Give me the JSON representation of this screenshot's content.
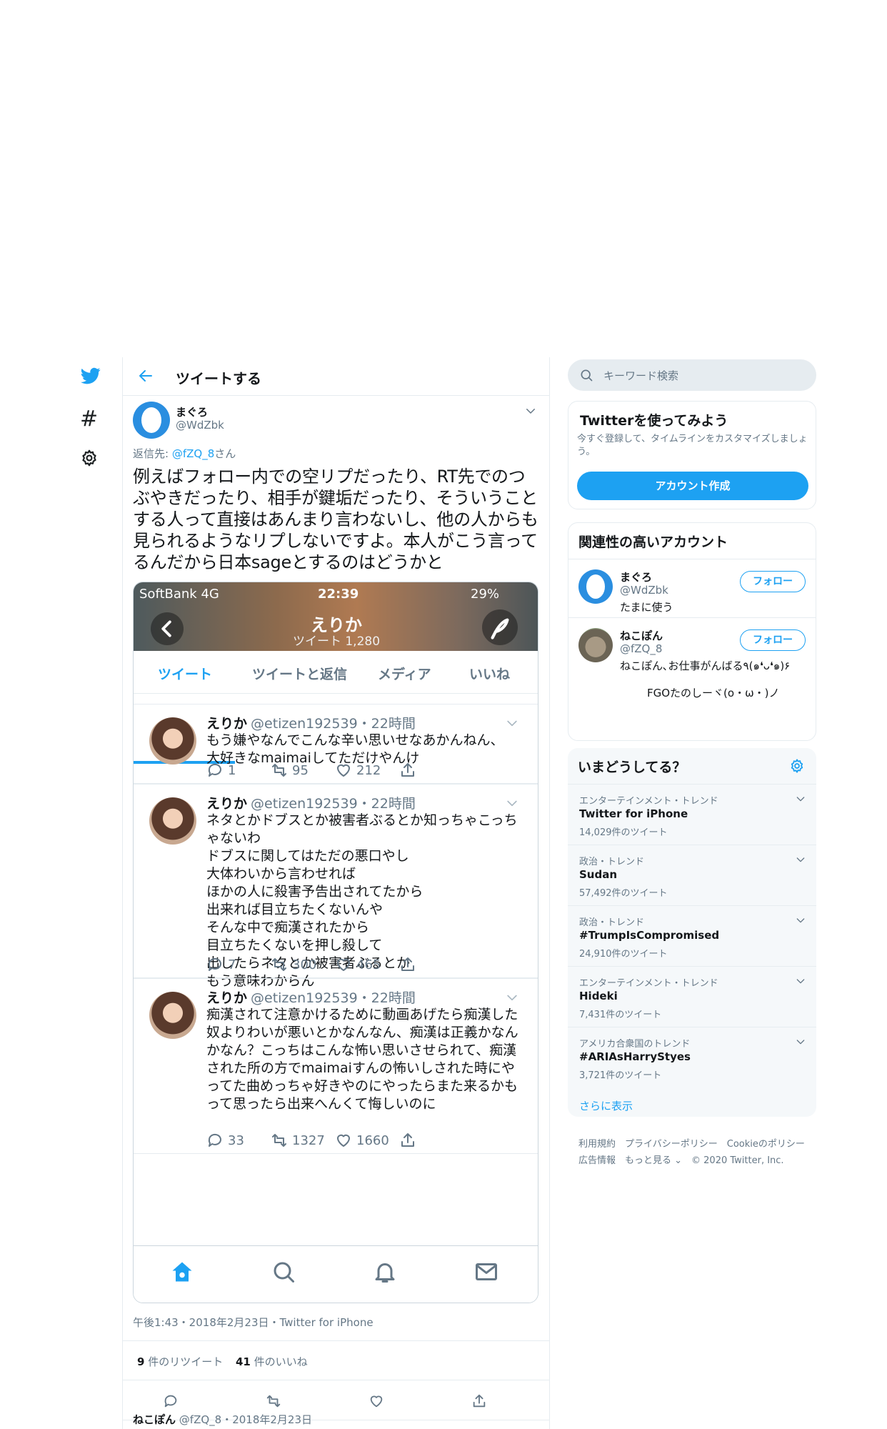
{
  "nav": {
    "bird_icon": "twitter-bird-icon",
    "hash_icon": "hashtag-icon",
    "hash_glyph": "#",
    "gear_icon": "gear-icon"
  },
  "header": {
    "title": "ツイートする"
  },
  "tweet": {
    "name": "まぐろ",
    "handle": "@WdZbk",
    "reply_prefix": "返信先: ",
    "reply_handle": "@fZQ_8",
    "reply_suffix": "さん",
    "text": "例えばフォロー内での空リプだったり、RT先でのつぶやきだったり、相手が鍵垢だったり、そういうことする人って直接はあんまり言わないし、他の人からも見られるようなリプしないですよ。本人がこう言ってるんだから日本sageとするのはどうかと",
    "meta": "午後1:43・2018年2月23日・Twitter for iPhone",
    "retweets_count": "9",
    "retweets_label": "件のリツイート",
    "likes_count": "41",
    "likes_label": "件のいいね"
  },
  "screenshot": {
    "carrier": "SoftBank  4G",
    "time": "22:39",
    "battery": "29%",
    "profile_name": "えりか",
    "profile_sub": "ツイート 1,280",
    "tabs": [
      "ツイート",
      "ツイートと返信",
      "メディア",
      "いいね"
    ],
    "cards": [
      {
        "name": "えりか",
        "handle": "@etizen192539・22時間",
        "body": "もう嫌やなんでこんな辛い思いせなあかんねん、\n大好きなmaimaiしてただけやんけ",
        "reply": "1",
        "rt": "95",
        "like": "212"
      },
      {
        "name": "えりか",
        "handle": "@etizen192539・22時間",
        "body": "ネタとかドブスとか被害者ぶるとか知っちゃこっちゃないわ\nドブスに関してはただの悪口やし\n大体わいから言わせれば\nほかの人に殺害予告出されてたから\n出来れば目立ちたくないんや\nそんな中で痴漢されたから\n目立ちたくないを押し殺して\n出したらネタとか被害者ぶるとか\nもう意味わからん",
        "reply": "7",
        "rt": "300",
        "like": "465"
      },
      {
        "name": "えりか",
        "handle": "@etizen192539・22時間",
        "body": "痴漢されて注意かけるために動画あげたら痴漢した奴よりわいが悪いとかなんなん、痴漢は正義かなんかなん？こっちはこんな怖い思いさせられて、痴漢された所の方でmaimaiすんの怖いしされた時にやってた曲めっちゃ好きやのにやったらまた来るかもって思ったら出来へんくて悔しいのに",
        "reply": "33",
        "rt": "1327",
        "like": "1660"
      }
    ]
  },
  "reply_preview": {
    "name": "ねこぽん",
    "handle": "@fZQ_8・2018年2月23日"
  },
  "search": {
    "placeholder": "キーワード検索"
  },
  "signup": {
    "title": "Twitterを使ってみよう",
    "desc": "今すぐ登録して、タイムラインをカスタマイズしましょう。",
    "button": "アカウント作成"
  },
  "relevant": {
    "title": "関連性の高いアカウント",
    "accounts": [
      {
        "name": "まぐろ",
        "handle": "@WdZbk",
        "bio": "たまに使う",
        "follow": "フォロー"
      },
      {
        "name": "ねこぽん",
        "handle": "@fZQ_8",
        "bio": "ねこぽん､お仕事がんばる٩(๑❛ᴗ❛๑)۶",
        "bio2": "FGOたのしーヾ(o・ω・)ノ",
        "follow": "フォロー"
      }
    ]
  },
  "trends": {
    "title": "いまどうしてる？",
    "items": [
      {
        "cat": "エンターテインメント・トレンド",
        "name": "Twitter for iPhone",
        "count": "14,029件のツイート"
      },
      {
        "cat": "政治・トレンド",
        "name": "Sudan",
        "count": "57,492件のツイート"
      },
      {
        "cat": "政治・トレンド",
        "name": "#TrumpIsCompromised",
        "count": "24,910件のツイート"
      },
      {
        "cat": "エンターテインメント・トレンド",
        "name": "Hideki",
        "count": "7,431件のツイート"
      },
      {
        "cat": "アメリカ合衆国のトレンド",
        "name": "#ARIAsHarryStyes",
        "count": "3,721件のツイート"
      }
    ],
    "more": "さらに表示"
  },
  "footer": {
    "line1": "利用規約　プライバシーポリシー　Cookieのポリシー",
    "line2": "広告情報　もっと見る ⌄　© 2020 Twitter, Inc."
  },
  "colors": {
    "accent": "#1da1f2",
    "text": "#14171a",
    "muted": "#657786",
    "border": "#e6ecf0"
  }
}
